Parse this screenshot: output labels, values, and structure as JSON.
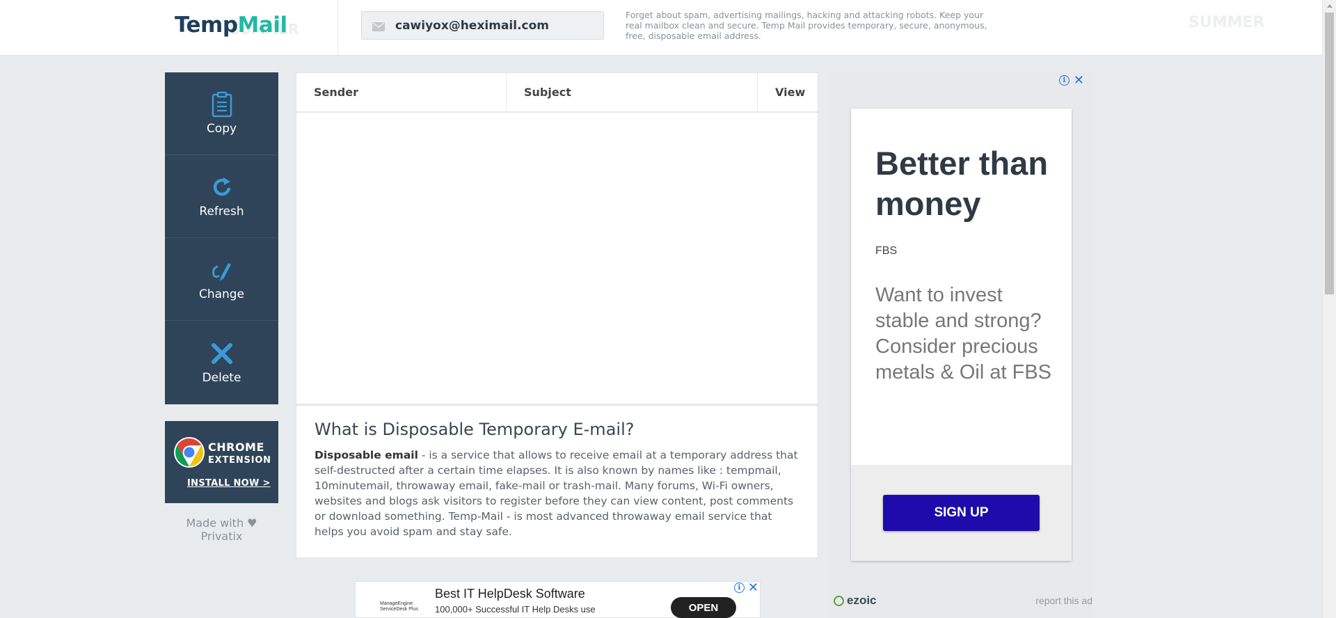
{
  "header": {
    "logo_part1": "Temp",
    "logo_part2": "Mail",
    "email": "cawiyox@heximail.com",
    "description": "Forget about spam, advertising mailings, hacking and attacking robots. Keep your real mailbox clean and secure. Temp Mail provides temporary, secure, anonymous, free, disposable email address.",
    "decor_text": "SUMMER"
  },
  "sidebar": {
    "buttons": [
      {
        "label": "Copy",
        "icon": "clipboard-icon"
      },
      {
        "label": "Refresh",
        "icon": "refresh-icon"
      },
      {
        "label": "Change",
        "icon": "pen-icon"
      },
      {
        "label": "Delete",
        "icon": "close-icon"
      }
    ],
    "chrome": {
      "line1": "CHROME",
      "line2": "EXTENSION",
      "cta": "INSTALL NOW >"
    },
    "made_with": "Made with ♥ Privatix"
  },
  "inbox": {
    "columns": [
      "Sender",
      "Subject",
      "View"
    ]
  },
  "info": {
    "title": "What is Disposable Temporary E-mail?",
    "bold_term": "Disposable email",
    "body": " - is a service that allows to receive email at a temporary address that self-destructed after a certain time elapses. It is also known by names like : tempmail, 10minutemail, throwaway email, fake-mail or trash-mail. Many forums, Wi-Fi owners, websites and blogs ask visitors to register before they can view content, post comments or download something. Temp-Mail - is most advanced throwaway email service that helps you avoid spam and stay safe."
  },
  "ad": {
    "title": "Better than money",
    "brand": "FBS",
    "body": "Want to invest stable and strong? Consider precious metals & Oil at FBS",
    "cta": "SIGN UP",
    "network": "ezoic",
    "report": "report this ad"
  },
  "bottom_ad": {
    "logo_text": "ManageEngine ServiceDesk Plus",
    "title": "Best IT HelpDesk Software",
    "subtitle": "100,000+ Successful IT Help Desks use",
    "cta": "OPEN"
  },
  "colors": {
    "sidebar_bg": "#2f4458",
    "icon_blue": "#3a9ad9",
    "logo_dark": "#1e3f5a",
    "logo_teal": "#22b9a3",
    "ad_button": "#1f0bab"
  }
}
